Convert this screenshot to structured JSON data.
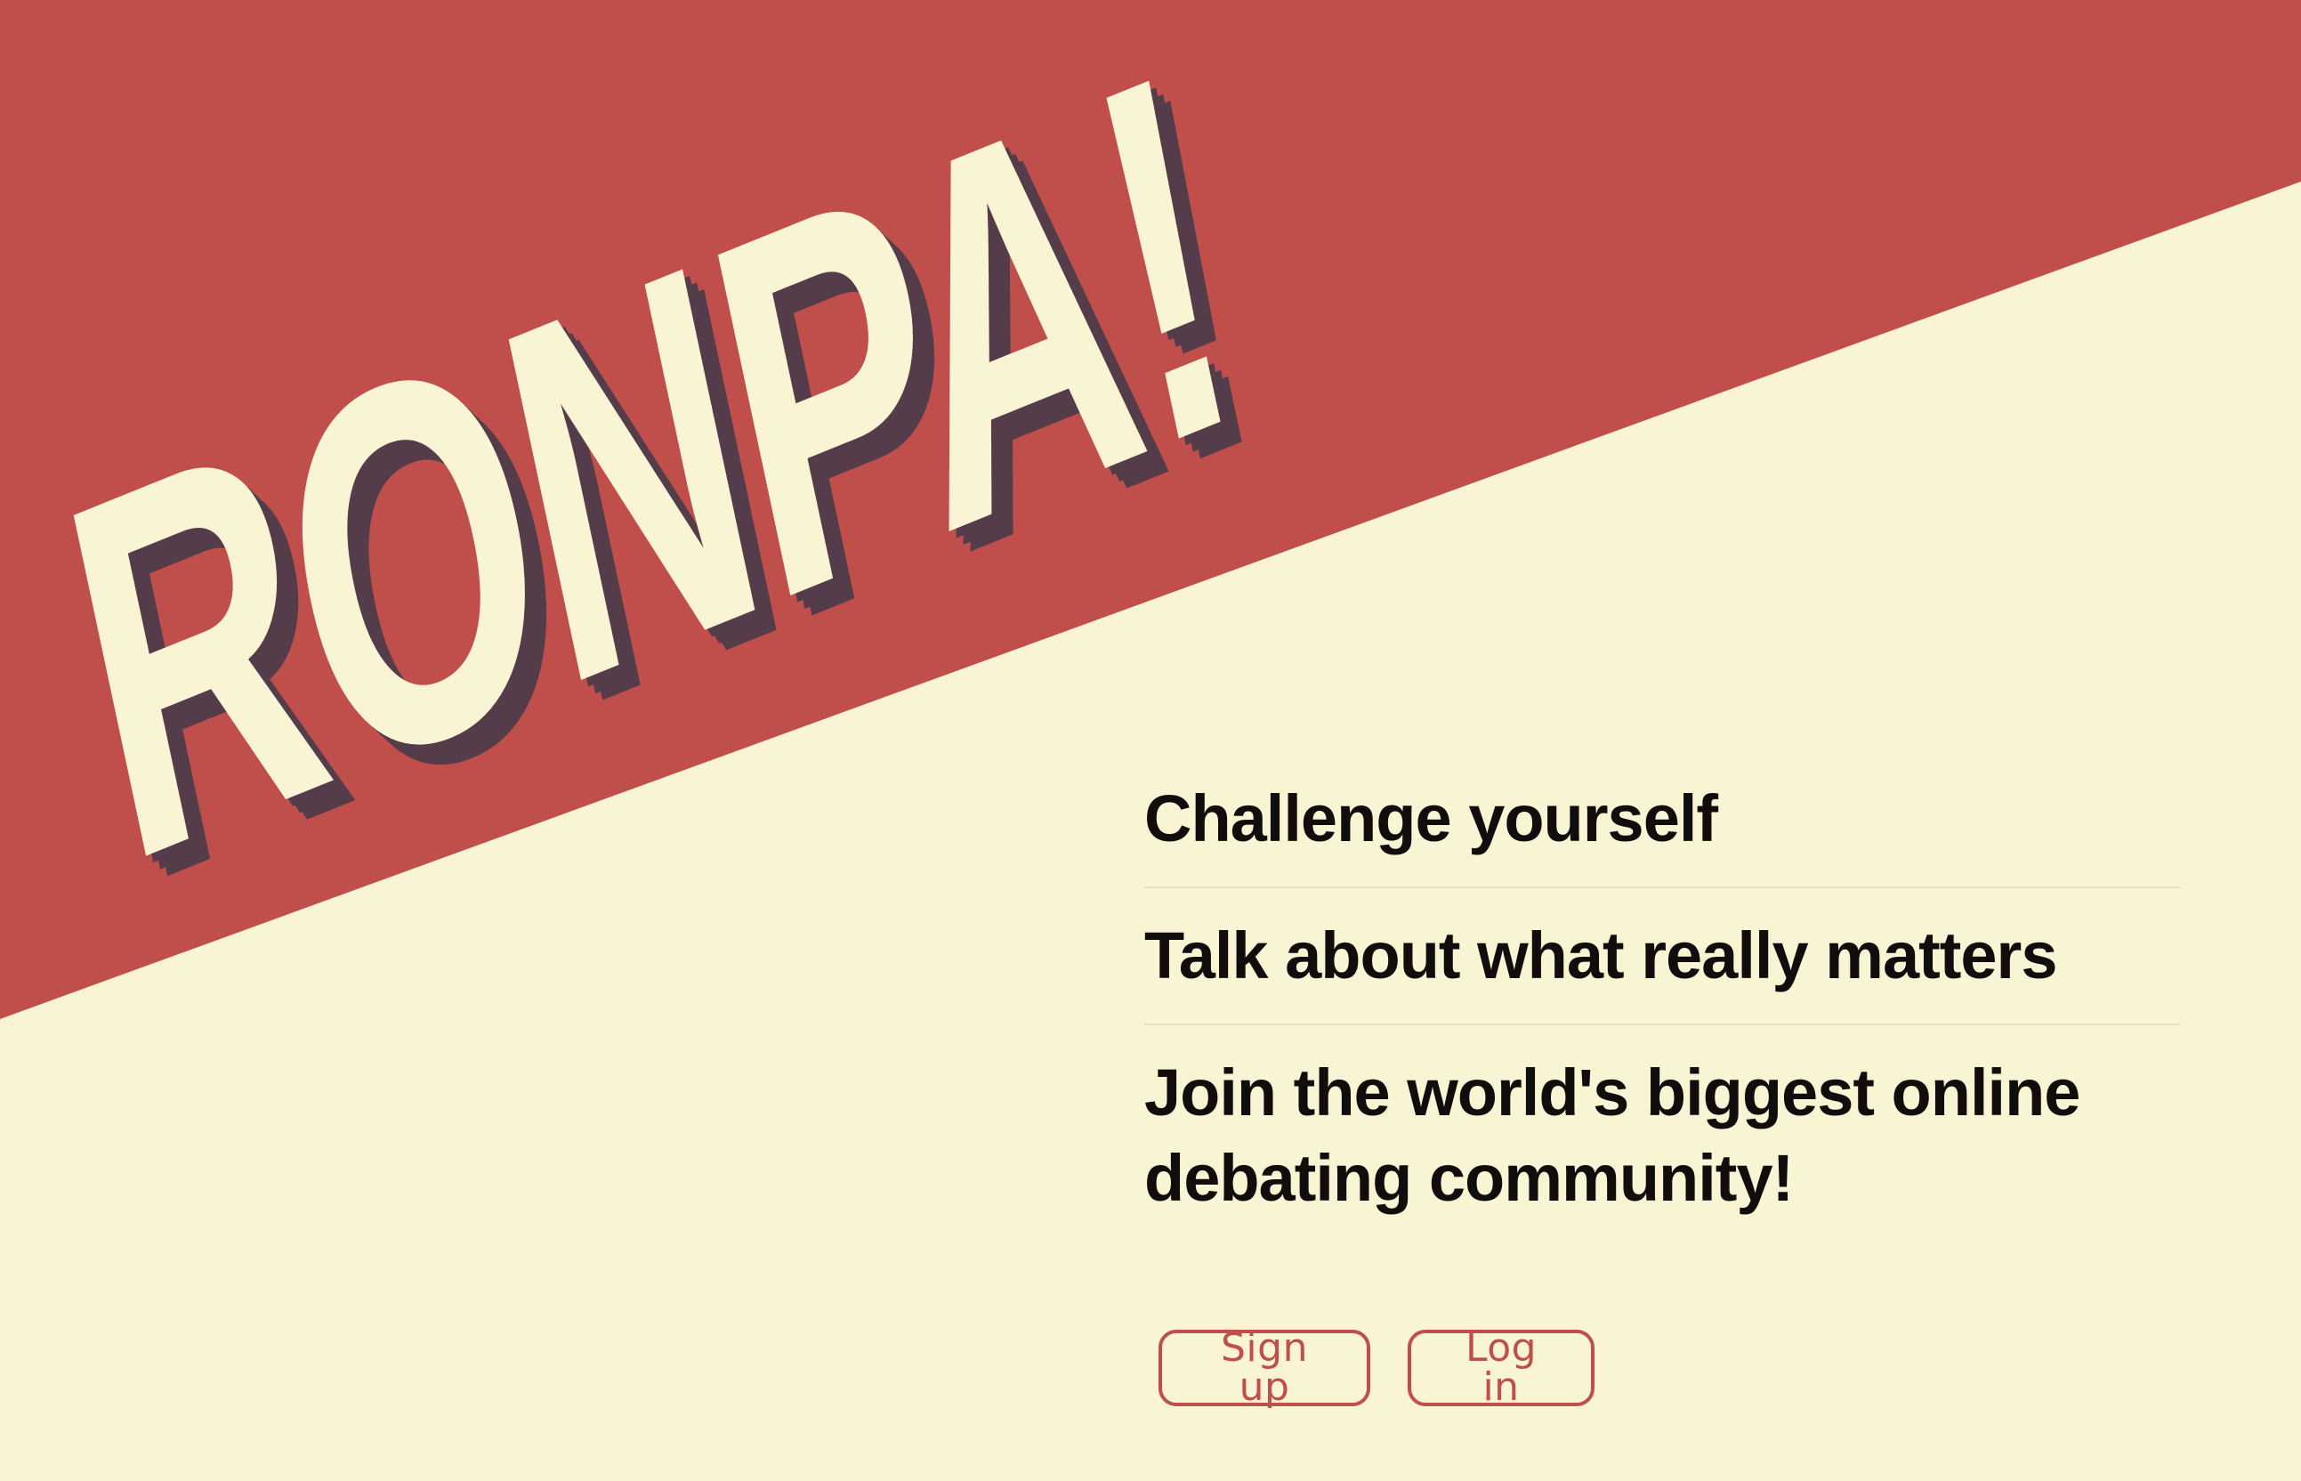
{
  "brand": {
    "title": "RONPA!"
  },
  "features": [
    "Challenge yourself",
    "Talk about what really matters",
    "Join the world's biggest online\ndebating community!"
  ],
  "actions": {
    "signup_label": "Sign up",
    "login_label": "Log in"
  },
  "colors": {
    "accent": "#c04f4b",
    "background": "#f9f4d4",
    "shadow": "#553c4a",
    "text": "#120d0d"
  }
}
